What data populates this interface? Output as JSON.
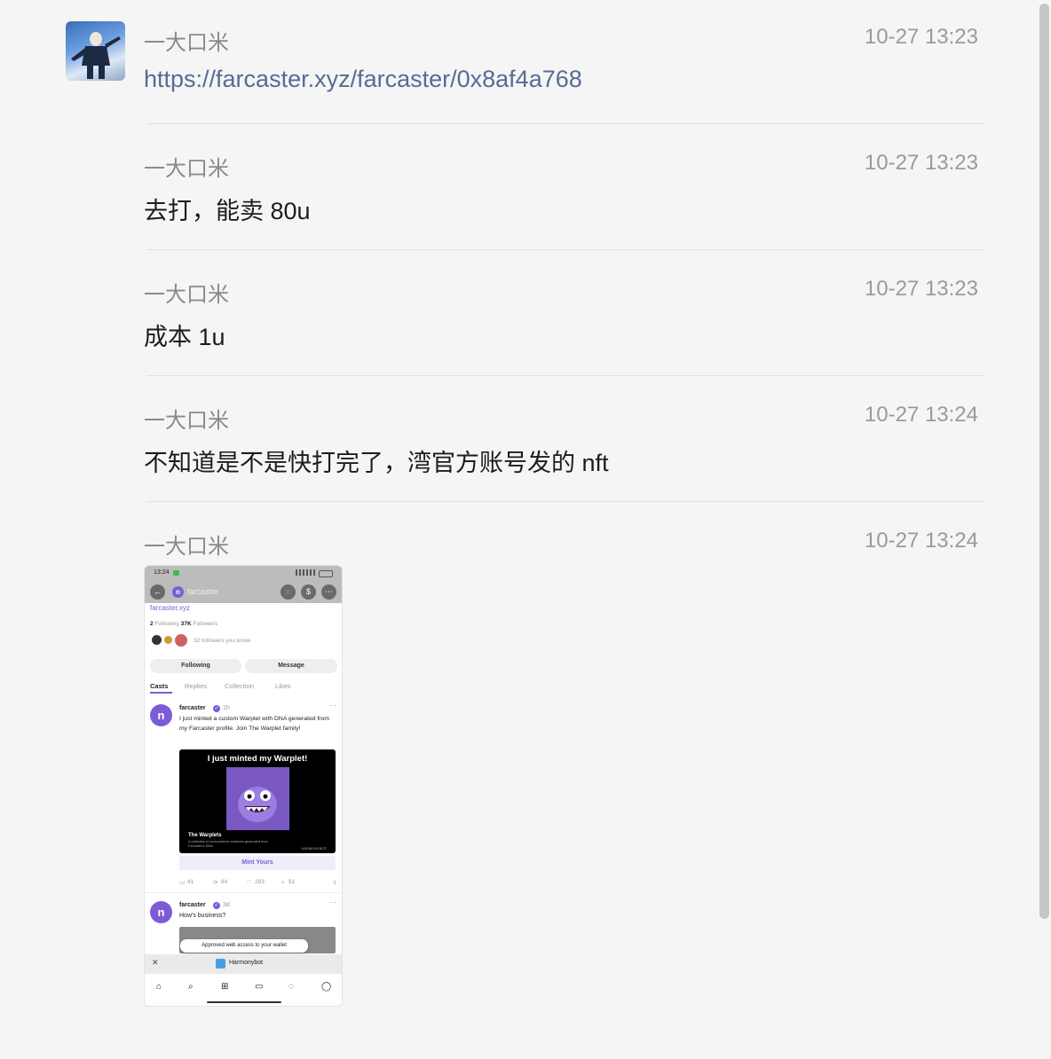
{
  "messages": [
    {
      "sender": "一大口米",
      "time": "10-27 13:23",
      "text": "https://farcaster.xyz/farcaster/0x8af4a768",
      "is_link": true
    },
    {
      "sender": "一大口米",
      "time": "10-27 13:23",
      "text": "去打，能卖 80u"
    },
    {
      "sender": "一大口米",
      "time": "10-27 13:23",
      "text": "成本 1u"
    },
    {
      "sender": "一大口米",
      "time": "10-27 13:24",
      "text": "不知道是不是快打完了，湾官方账号发的 nft"
    },
    {
      "sender": "一大口米",
      "time": "10-27 13:24",
      "image": true
    }
  ],
  "screenshot": {
    "status_time": "13:24",
    "nav_title": "farcaster",
    "profile_link": "farcaster.xyz",
    "following_count": "2",
    "following_label": "Following",
    "followers_count": "37K",
    "followers_label": "Followers",
    "followers_you_know": "32 followers you know",
    "following_button": "Following",
    "message_button": "Message",
    "tabs": [
      "Casts",
      "Replies",
      "Collection",
      "Likes"
    ],
    "post1": {
      "author": "farcaster",
      "age": "1h",
      "text": "I just minted a custom Warplet with DNA generated from my Farcaster profile. Join The Warplet family!",
      "card_title": "I just minted my Warplet!",
      "card_name": "The Warplets",
      "card_desc": "A collection of personalized creatures generated from Farcaster's DNA.",
      "card_brand": "HARMONYBOT",
      "mint_button": "Mint Yours",
      "replies": "41",
      "recasts": "84",
      "likes": "283",
      "tips": "$1"
    },
    "post2": {
      "author": "farcaster",
      "age": "3d",
      "text": "How's business?"
    },
    "toast": "Approved web access to your wallet",
    "bottom_app": "Harmonybot",
    "close_glyph": "✕"
  }
}
